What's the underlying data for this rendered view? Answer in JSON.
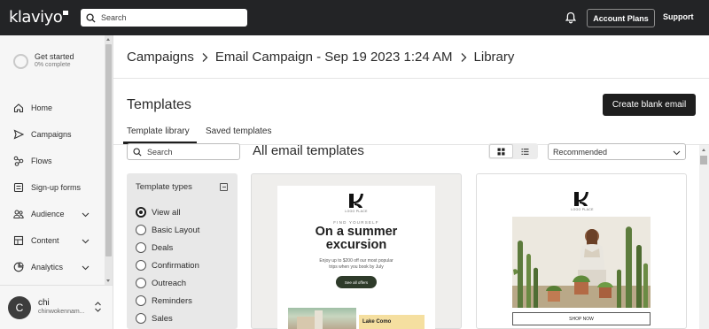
{
  "app": {
    "logo": "klaviyo"
  },
  "topbar": {
    "search_placeholder": "Search",
    "account_plans": "Account Plans",
    "support": "Support"
  },
  "sidebar": {
    "get_started": {
      "title": "Get started",
      "progress": "0% complete"
    },
    "items": [
      {
        "label": "Home",
        "icon": "home-icon"
      },
      {
        "label": "Campaigns",
        "icon": "send-icon"
      },
      {
        "label": "Flows",
        "icon": "flows-icon"
      },
      {
        "label": "Sign-up forms",
        "icon": "form-icon"
      },
      {
        "label": "Audience",
        "icon": "people-icon",
        "expandable": true
      },
      {
        "label": "Content",
        "icon": "content-icon",
        "expandable": true
      },
      {
        "label": "Analytics",
        "icon": "analytics-icon",
        "expandable": true
      }
    ],
    "user": {
      "initial": "C",
      "name": "chi",
      "email": "chinwokennam..."
    }
  },
  "breadcrumb": [
    "Campaigns",
    "Email Campaign - Sep 19 2023 1:24 AM",
    "Library"
  ],
  "page": {
    "title": "Templates",
    "create_button": "Create blank email",
    "tabs": [
      {
        "label": "Template library",
        "active": true
      },
      {
        "label": "Saved templates",
        "active": false
      }
    ]
  },
  "filters": {
    "search_placeholder": "Search",
    "title": "Template types",
    "options": [
      {
        "label": "View all",
        "selected": true
      },
      {
        "label": "Basic Layout",
        "selected": false
      },
      {
        "label": "Deals",
        "selected": false
      },
      {
        "label": "Confirmation",
        "selected": false
      },
      {
        "label": "Outreach",
        "selected": false
      },
      {
        "label": "Reminders",
        "selected": false
      },
      {
        "label": "Sales",
        "selected": false
      }
    ]
  },
  "library": {
    "title": "All email templates",
    "sort_value": "Recommended",
    "view": "grid"
  },
  "templates": [
    {
      "logo_text": "LOGO PLACE",
      "eyebrow": "FIND YOURSELF",
      "headline_1": "On a summer",
      "headline_2": "excursion",
      "body_1": "Enjoy up to $200 off our most popular",
      "body_2": "trips when you book by July",
      "cta": "See all offers",
      "card_title": "Lake Como",
      "cta_color": "#2e3b2a",
      "card_color": "#f5dfa0"
    },
    {
      "logo_text": "LOGO PLACE",
      "cta": "SHOP NOW"
    }
  ],
  "colors": {
    "topbar": "#232426",
    "primary_button": "#1e1e1e",
    "sidebar": "#f6f6f6"
  }
}
